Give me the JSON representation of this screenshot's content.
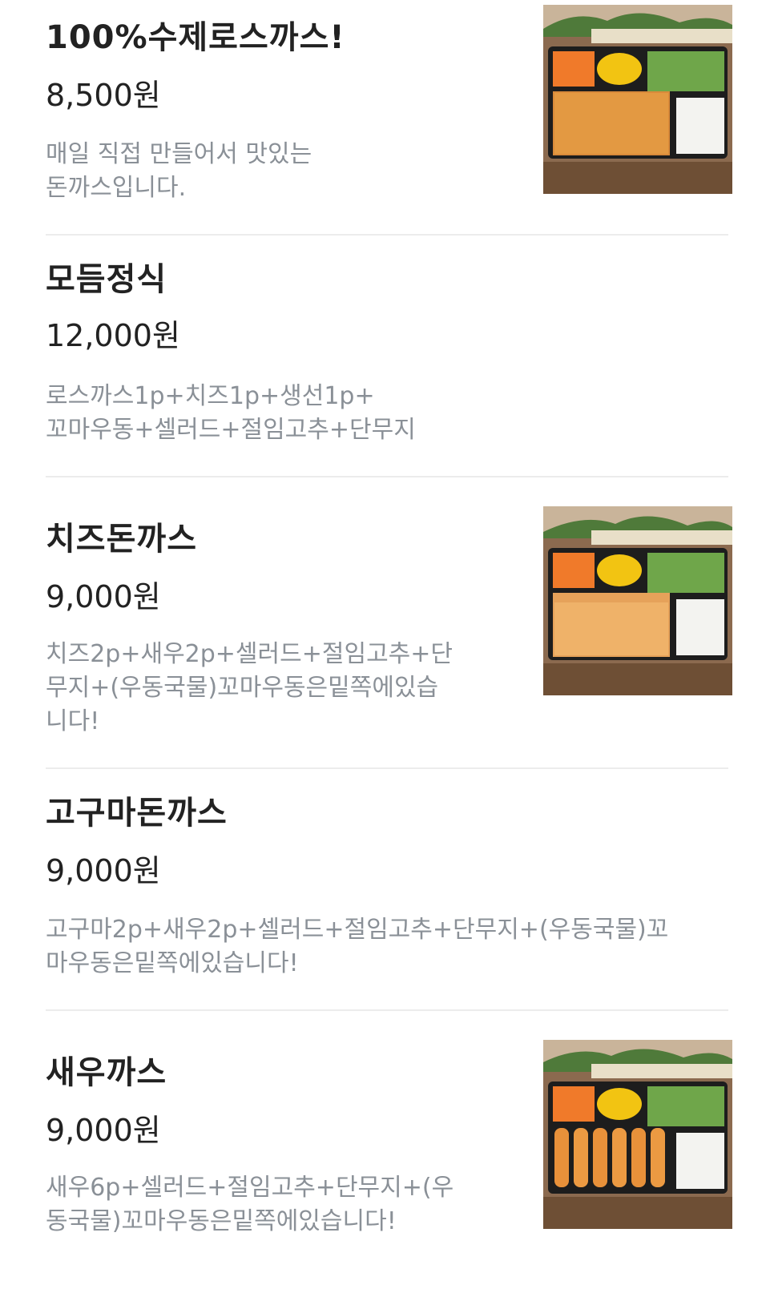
{
  "menu_items": [
    {
      "name": "100%수제로스까스!",
      "price": "8,500원",
      "description": [
        "매일 직접 만들어서 맛있는",
        "돈까스입니다."
      ],
      "has_image": true,
      "image_icon": "tonkatsu-lunchbox-photo"
    },
    {
      "name": "모듬정식",
      "price": "12,000원",
      "description": [
        "로스까스1p+치즈1p+생선1p+",
        "꼬마우동+셀러드+절임고추+단무지"
      ],
      "has_image": false
    },
    {
      "name": "치즈돈까스",
      "price": "9,000원",
      "description": [
        "치즈2p+새우2p+셀러드+절임고추+단",
        "무지+(우동국물)꼬마우동은밑쪽에있습",
        "니다!"
      ],
      "has_image": true,
      "image_icon": "cheese-katsu-lunchbox-photo"
    },
    {
      "name": "고구마돈까스",
      "price": "9,000원",
      "description": [
        "고구마2p+새우2p+셀러드+절임고추+단무지+(우동국물)꼬",
        "마우동은밑쪽에있습니다!"
      ],
      "has_image": false
    },
    {
      "name": "새우까스",
      "price": "9,000원",
      "description": [
        "새우6p+셀러드+절임고추+단무지+(우",
        "동국물)꼬마우동은밑쪽에있습니다!"
      ],
      "has_image": true,
      "image_icon": "shrimp-katsu-lunchbox-photo"
    }
  ],
  "colors": {
    "title": "#222222",
    "description": "#8a9097",
    "divider": "#ececec"
  }
}
